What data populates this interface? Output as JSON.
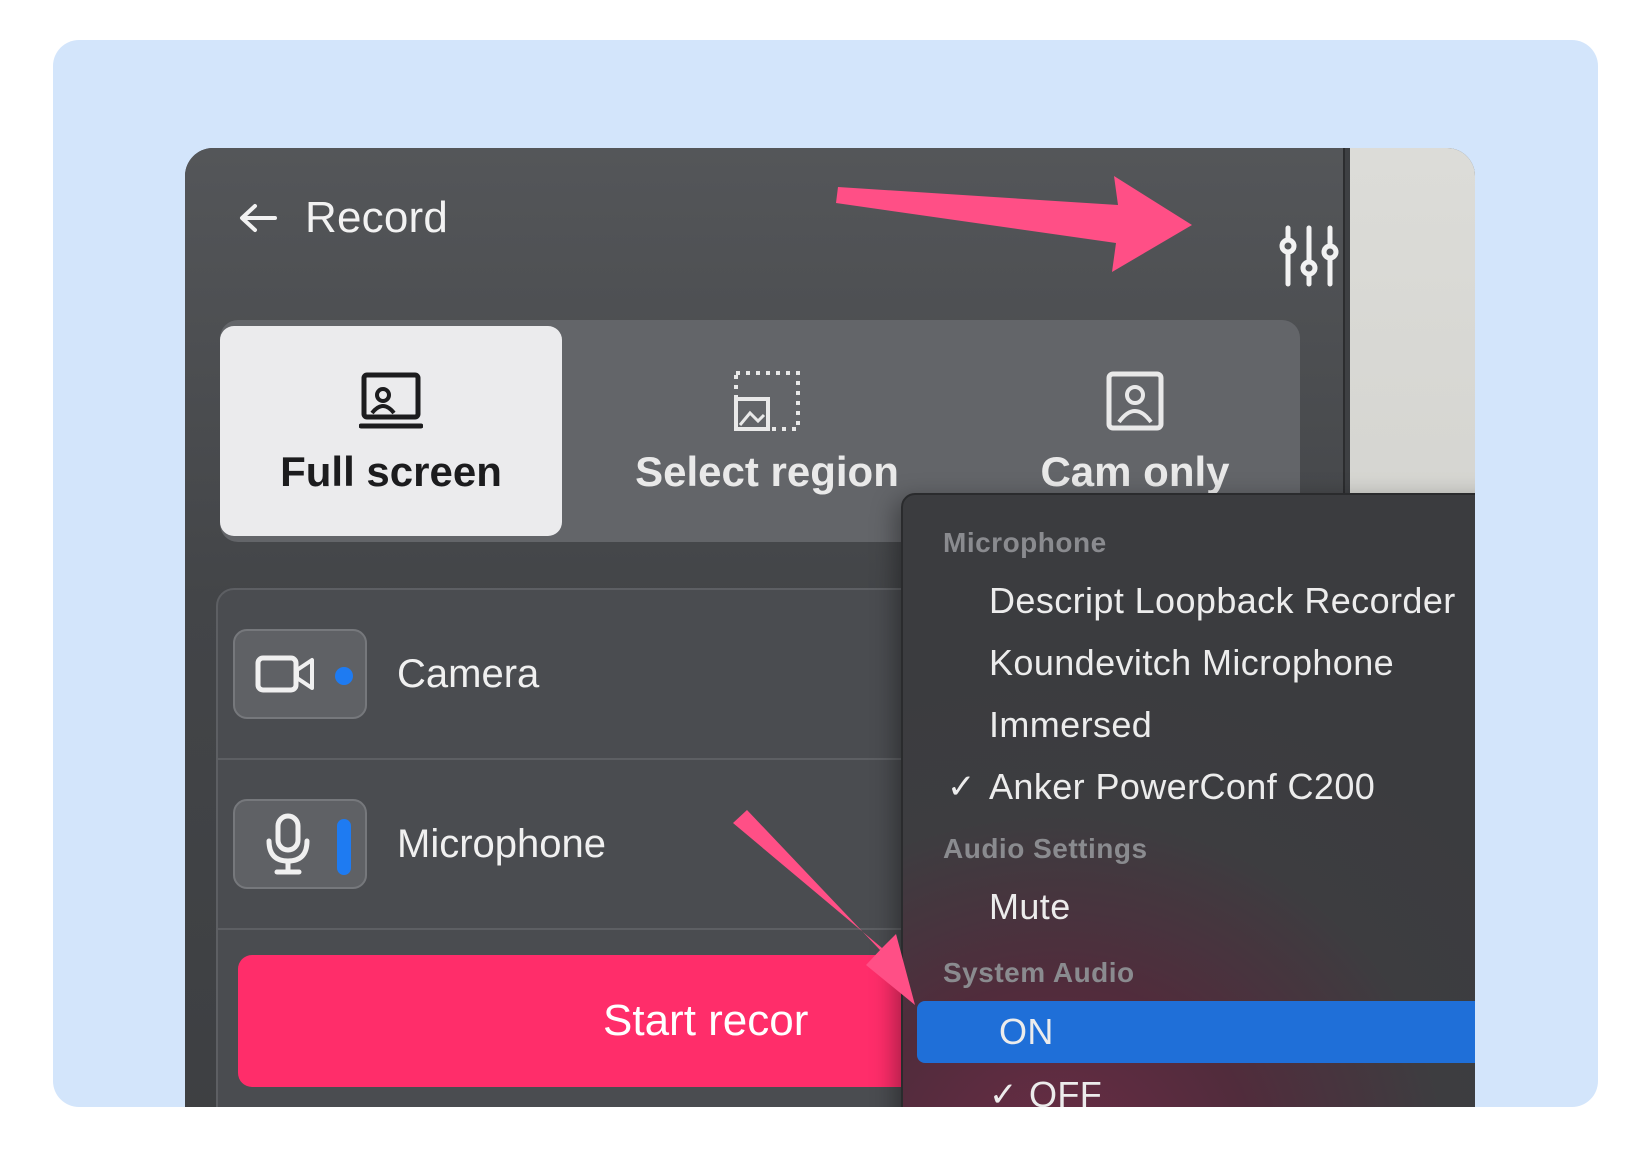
{
  "header": {
    "title": "Record"
  },
  "modes": [
    {
      "label": "Full screen",
      "active": true
    },
    {
      "label": "Select region",
      "active": false
    },
    {
      "label": "Cam only",
      "active": false
    }
  ],
  "devices": {
    "camera_label": "Camera",
    "microphone_label": "Microphone"
  },
  "start_button": {
    "label": "Start recor"
  },
  "menu": {
    "microphone_header": "Microphone",
    "microphone_options": [
      {
        "label": "Descript Loopback Recorder",
        "checked": false
      },
      {
        "label": "Koundevitch Microphone",
        "checked": false
      },
      {
        "label": "Immersed",
        "checked": false
      },
      {
        "label": "Anker PowerConf C200",
        "checked": true
      }
    ],
    "audio_settings_header": "Audio Settings",
    "mute_label": "Mute",
    "system_audio_header": "System Audio",
    "system_audio_on": "ON",
    "system_audio_off": "OFF",
    "check_mark": "✓"
  },
  "colors": {
    "accent_blue": "#1f6fd8",
    "record_pink": "#ff2d6a",
    "annotation_arrow": "#ff4f86"
  }
}
